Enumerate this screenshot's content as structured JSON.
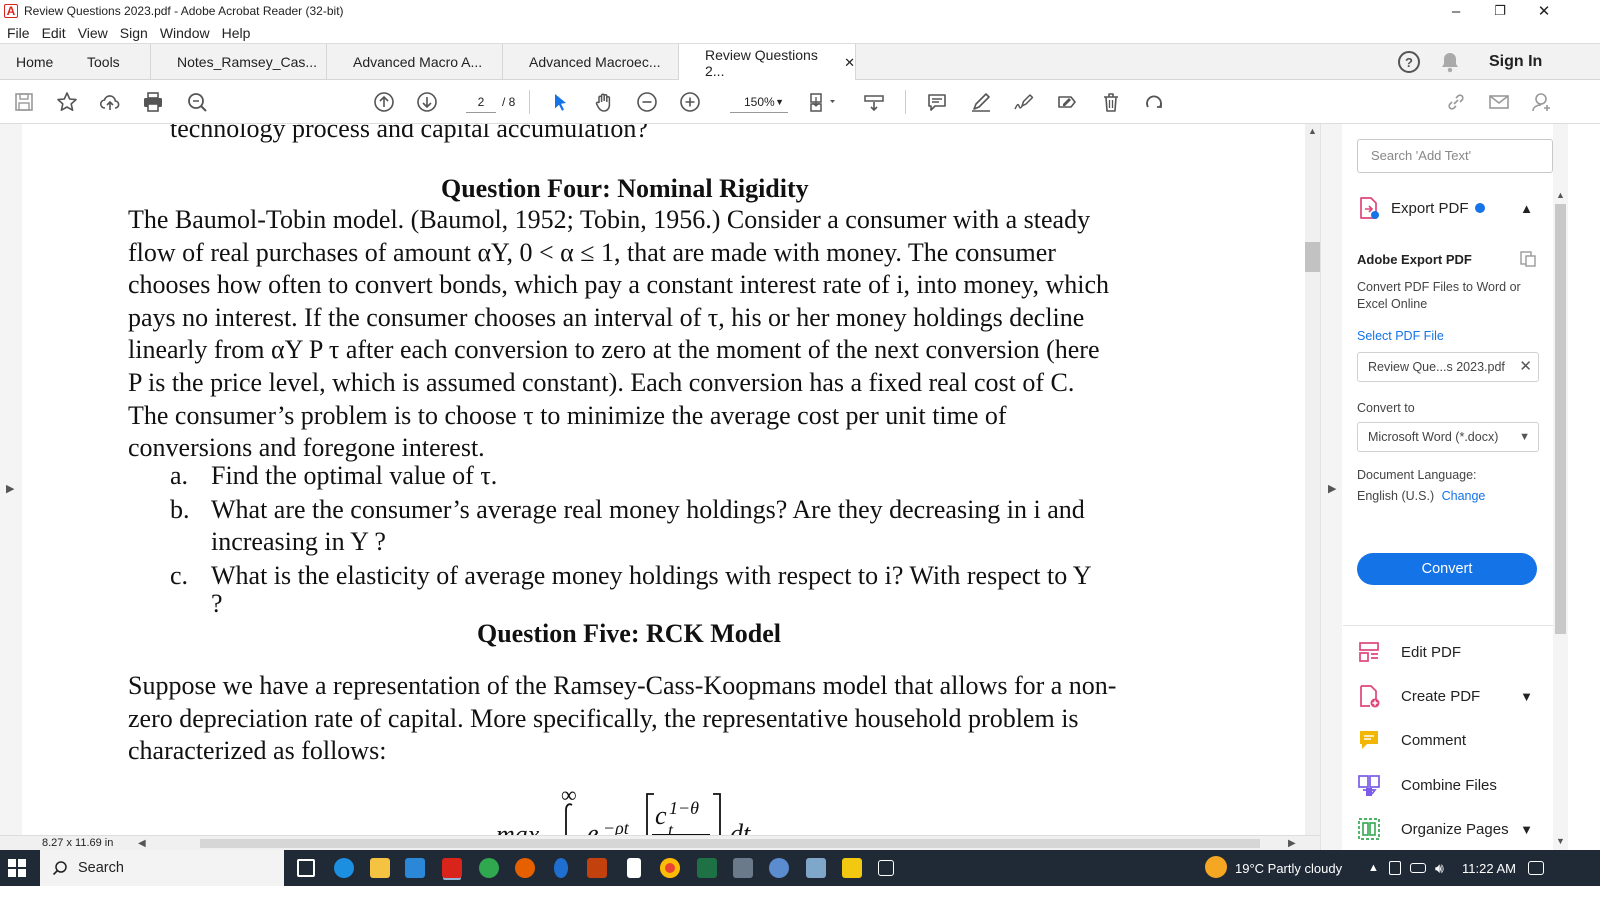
{
  "window": {
    "title": "Review Questions 2023.pdf - Adobe Acrobat Reader (32-bit)",
    "minimize": "–",
    "restore": "❐",
    "close": "✕"
  },
  "menu": [
    "File",
    "Edit",
    "View",
    "Sign",
    "Window",
    "Help"
  ],
  "tabs": {
    "home": "Home",
    "tools": "Tools",
    "docs": [
      {
        "label": "Notes_Ramsey_Cas..."
      },
      {
        "label": "Advanced Macro A..."
      },
      {
        "label": "Advanced Macroec..."
      },
      {
        "label": "Review Questions 2...",
        "active": true
      }
    ],
    "close_glyph": "✕",
    "help_glyph": "?",
    "sign_in": "Sign In"
  },
  "toolbar": {
    "page_current": "2",
    "page_total": "/ 8",
    "zoom": "150%"
  },
  "document": {
    "top_fragment": "technology process and capital accumulation?",
    "q4_title": "Question Four: Nominal Rigidity",
    "q4_line1": "The Baumol-Tobin model. (Baumol, 1952; Tobin, 1956.) Consider a consumer with a steady",
    "q4_line2": "flow of real purchases of amount αY, 0 < α ≤ 1, that are made with money. The consumer",
    "q4_line3": "chooses how often to convert bonds, which pay a constant interest rate of i, into money, which",
    "q4_line4": "pays no interest. If the consumer chooses an interval of τ, his or her money holdings decline",
    "q4_line5": "linearly from αY P τ after each conversion to zero at the moment of the next conversion (here",
    "q4_line6": "P is the price level, which is assumed constant). Each conversion has a fixed real cost of C.",
    "q4_line7": "The consumer’s problem is to choose τ to minimize the average cost per unit time of",
    "q4_line8": "conversions and foregone interest.",
    "items": [
      {
        "label": "a.",
        "line1": "Find the optimal value of τ.",
        "line2": ""
      },
      {
        "label": "b.",
        "line1": "What are the consumer’s average real money holdings? Are they decreasing in i and",
        "line2": "increasing in Y ?"
      },
      {
        "label": "c.",
        "line1": "What is the elasticity of average money holdings with respect to i? With respect to Y",
        "line2": "?"
      }
    ],
    "q5_title": "Question Five: RCK Model",
    "q5_line1": "Suppose we have a representation of the Ramsey-Cass-Koopmans model that allows for a non-",
    "q5_line2": "zero depreciation rate of capital. More specifically, the representative household problem is",
    "q5_line3": "characterized as follows:",
    "eq_infinity": "∞",
    "eq_max": "max",
    "eq_exp": "e",
    "eq_exp_sup": "−ρt",
    "eq_c": "c",
    "eq_c_sup": "1−θ",
    "eq_c_sub": "t",
    "eq_dt": "dt"
  },
  "status": {
    "page_size": "8.27 x 11.69 in"
  },
  "right_panel": {
    "search_placeholder": "Search 'Add Text'",
    "export_pdf": "Export PDF",
    "heading": "Adobe Export PDF",
    "description": "Convert PDF Files to Word or Excel Online",
    "select_file": "Select PDF File",
    "file_name": "Review Que...s 2023.pdf",
    "convert_to_label": "Convert to",
    "convert_to_value": "Microsoft Word (*.docx)",
    "doc_lang_label": "Document Language:",
    "doc_lang_value": "English (U.S.)",
    "doc_lang_change": "Change",
    "convert_button": "Convert",
    "tools": [
      {
        "label": "Edit PDF",
        "color": "#e0457b"
      },
      {
        "label": "Create PDF",
        "color": "#e0457b"
      },
      {
        "label": "Comment",
        "color": "#f2b705"
      },
      {
        "label": "Combine Files",
        "color": "#7b5ce6"
      },
      {
        "label": "Organize Pages",
        "color": "#34a853"
      }
    ]
  },
  "taskbar": {
    "search": "Search",
    "weather": "19°C  Partly cloudy",
    "time": "11:22 AM"
  },
  "colors": {
    "accent": "#1473e6",
    "acrobat_red": "#d9241c",
    "taskbar": "#1f2a36"
  }
}
